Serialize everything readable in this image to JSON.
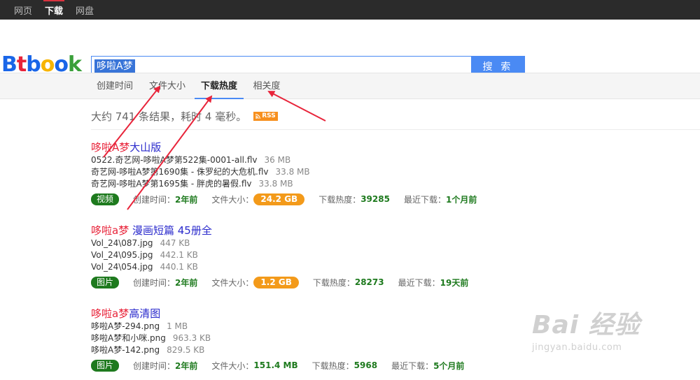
{
  "topnav": {
    "items": [
      "网页",
      "下载",
      "网盘"
    ],
    "active": 1
  },
  "logo": {
    "text": "Btbook"
  },
  "search": {
    "query": "哆啦A梦",
    "button_label": "搜 索"
  },
  "sort_tabs": [
    {
      "label": "创建时间"
    },
    {
      "label": "文件大小"
    },
    {
      "label": "下载热度"
    },
    {
      "label": "相关度"
    }
  ],
  "stats": {
    "text": "大约 741 条结果，耗时 4 毫秒。",
    "rss_label": "RSS"
  },
  "results": [
    {
      "title_highlight": "哆啦A梦",
      "title_rest": "大山版",
      "files": [
        {
          "name": "0522.奇艺网-哆啦A梦第522集-0001-all.flv",
          "size": "36 MB"
        },
        {
          "name": "奇艺网-哆啦A梦第1690集 - 侏罗纪的大危机.flv",
          "size": "33.8 MB"
        },
        {
          "name": "奇艺网-哆啦A梦第1695集 - 胖虎的暑假.flv",
          "size": "33.8 MB"
        }
      ],
      "category": "视频",
      "created_label": "创建时间：",
      "created": "2年前",
      "size_label": "文件大小：",
      "total_size": "24.2 GB",
      "heat_label": "下载热度：",
      "heat": "39285",
      "recent_label": "最近下载：",
      "recent": "1个月前"
    },
    {
      "title_highlight": "哆啦a梦",
      "title_rest": " 漫画短篇 45册全",
      "files": [
        {
          "name": "Vol_24\\087.jpg",
          "size": "447 KB"
        },
        {
          "name": "Vol_24\\095.jpg",
          "size": "442.1 KB"
        },
        {
          "name": "Vol_24\\054.jpg",
          "size": "440.1 KB"
        }
      ],
      "category": "图片",
      "created_label": "创建时间：",
      "created": "2年前",
      "size_label": "文件大小：",
      "total_size": "1.2 GB",
      "heat_label": "下载热度：",
      "heat": "28273",
      "recent_label": "最近下载：",
      "recent": "19天前"
    },
    {
      "title_highlight": "哆啦a梦",
      "title_rest": "高清图",
      "files": [
        {
          "name": "哆啦A梦-294.png",
          "size": "1 MB"
        },
        {
          "name": "哆啦A梦和小咪.png",
          "size": "963.3 KB"
        },
        {
          "name": "哆啦A梦-142.png",
          "size": "829.5 KB"
        }
      ],
      "category": "图片",
      "created_label": "创建时间：",
      "created": "2年前",
      "size_label": "文件大小：",
      "total_size": "151.4 MB",
      "heat_label": "下载热度：",
      "heat": "5968",
      "recent_label": "最近下载：",
      "recent": "5个月前"
    }
  ],
  "watermark": {
    "main": "Bai 经验",
    "sub": "jingyan.baidu.com"
  },
  "colors": {
    "accent": "#4a8af4",
    "highlight": "#e8243a",
    "link": "#2a2acc",
    "green": "#1e7a1e",
    "orange": "#f39a1a",
    "annotation_arrow": "#e8243a"
  }
}
